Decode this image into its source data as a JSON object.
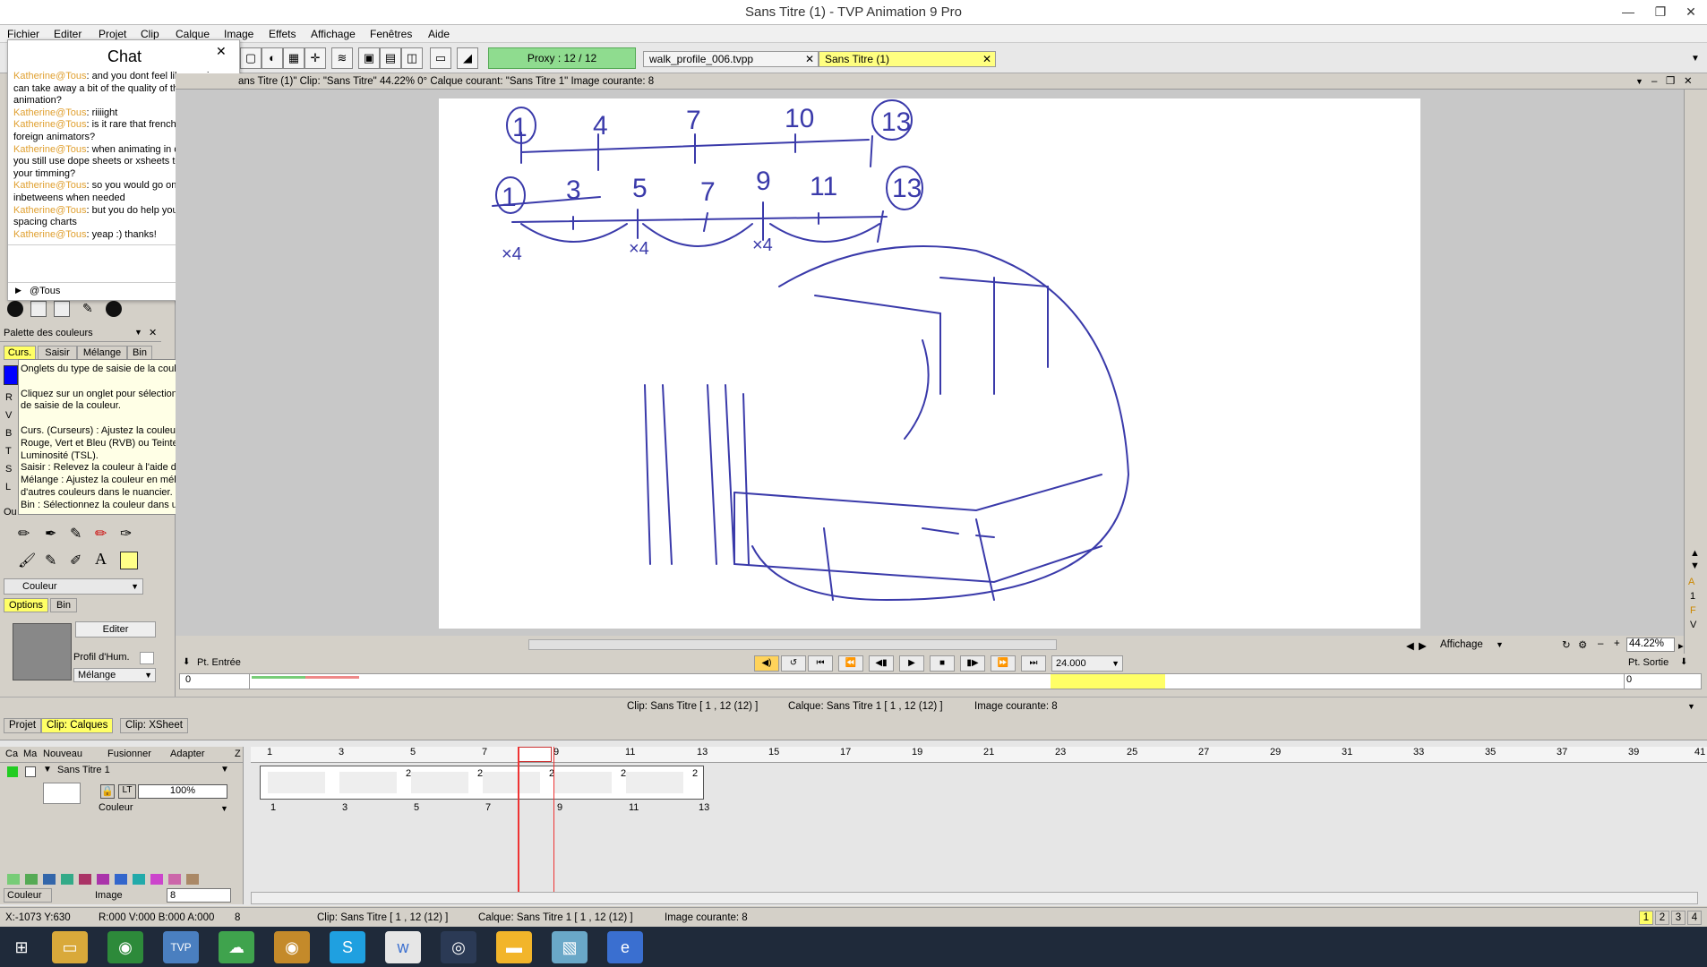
{
  "window": {
    "title": "Sans Titre (1) - TVP Animation 9 Pro",
    "min": "—",
    "max": "❐",
    "close": "✕"
  },
  "menu": [
    "Fichier",
    "Editer",
    "Projet",
    "Clip",
    "Calque",
    "Image",
    "Effets",
    "Affichage",
    "Fenêtres",
    "Aide"
  ],
  "toolbar": {
    "proxy": "Proxy : 12 / 12",
    "tabs": [
      {
        "label": "walk_profile_006.tvpp",
        "close": "✕"
      },
      {
        "label": "Sans Titre (1)",
        "close": "✕"
      }
    ]
  },
  "chat": {
    "title": "Chat",
    "close": "✕",
    "channel": "@Tous",
    "messages": [
      {
        "who": "Katherine@Tous",
        "text": ": and you dont feel like reusing can take away a bit of the quality of the animation?"
      },
      {
        "who": "Katherine@Tous",
        "text": ": riiiight"
      },
      {
        "who": "Katherine@Tous",
        "text": ": is it rare that french studios hire foreign animators?"
      },
      {
        "who": "Katherine@Tous",
        "text": ": when animating in digitally, do you still use dope sheets or xsheets to plan out your timming?"
      },
      {
        "who": "Katherine@Tous",
        "text": ": so you would go on with adding inbetweens when needed"
      },
      {
        "who": "Katherine@Tous",
        "text": ": but you do help yourself with spacing charts"
      },
      {
        "who": "Katherine@Tous",
        "text": ": yeap :) thanks!"
      }
    ]
  },
  "palette": {
    "title": "Palette des couleurs",
    "tabs": [
      "Curs.",
      "Saisir",
      "Mélange",
      "Bin"
    ],
    "channels": [
      "R",
      "V",
      "B",
      "T",
      "S",
      "L"
    ],
    "out_label": "Ou"
  },
  "tooltip": {
    "lines": [
      "Onglets du type de saisie de la couleur principale",
      "",
      "Cliquez sur un onglet pour sélectionner le type",
      "de saisie de la couleur.",
      "",
      "Curs. (Curseurs) : Ajustez la couleur selon les canaux",
      "Rouge, Vert et Bleu (RVB) ou Teinte, Saturation et",
      "Luminosité (TSL).",
      "Saisir : Relevez la couleur à l'aide d'une pipette.",
      "Mélange : Ajustez la couleur en mélangeant",
      "d'autres couleurs dans le nuancier.",
      "Bin : Sélectionnez la couleur dans une palette."
    ]
  },
  "tools": {
    "dropdown": "Couleur",
    "tabs": [
      "Options",
      "Bin"
    ],
    "edit_button": "Editer",
    "profile": "Profil d'Hum.",
    "mode": "Mélange"
  },
  "view": {
    "header": "ans Titre (1)\"  Clip: \"Sans Titre\"   44.22%   0°   Calque courant: \"Sans Titre 1\"   Image courante: 8"
  },
  "play": {
    "pt_entree": "Pt. Entrée",
    "pt_sortie": "Pt. Sortie",
    "fps": "24.000",
    "affichage": "Affichage",
    "zoom": "44.22%",
    "in_value": "0",
    "out_value": "0"
  },
  "right_labels": [
    "A",
    "1",
    "F",
    "V"
  ],
  "info": {
    "clip": "Clip: Sans Titre [ 1 , 12  (12) ]",
    "layer": "Calque: Sans Titre 1 [ 1 , 12  (12) ]",
    "image": "Image courante: 8"
  },
  "timeline": {
    "tabs": [
      "Projet",
      "Clip: Calques",
      "Clip: XSheet"
    ],
    "headers": [
      "Ca",
      "Ma",
      "Nouveau",
      "Fusionner",
      "Adapter",
      "Z"
    ],
    "layer": {
      "name": "Sans Titre 1",
      "opacity": "100%",
      "mode": "Couleur",
      "lt": "LT"
    },
    "ruler": [
      "1",
      "3",
      "5",
      "7",
      "9",
      "11",
      "13",
      "15",
      "17",
      "19",
      "21",
      "23",
      "25",
      "27",
      "29",
      "31",
      "33",
      "35",
      "37",
      "39",
      "41"
    ],
    "keys": [
      "1",
      "3",
      "5",
      "7",
      "9",
      "11",
      "13"
    ],
    "holds": [
      "2",
      "2",
      "2",
      "2",
      "2",
      "2"
    ],
    "bottom": {
      "color": "Couleur",
      "image": "Image",
      "value": "8"
    }
  },
  "status": {
    "coords": "X:-1073 Y:630",
    "rgba": "R:000 V:000 B:000 A:000",
    "num": "8",
    "clip": "Clip: Sans Titre [ 1 , 12  (12) ]",
    "layer": "Calque: Sans Titre 1 [ 1 , 12  (12) ]",
    "image": "Image courante: 8",
    "pages": [
      "1",
      "2",
      "3",
      "4"
    ]
  },
  "taskbar": {
    "apps": [
      {
        "name": "windows-start-icon",
        "glyph": "⊞",
        "color": "#1f2a3a"
      },
      {
        "name": "file-explorer-icon",
        "glyph": "▭",
        "color": "#d9a93a"
      },
      {
        "name": "chrome-icon",
        "glyph": "◉",
        "color": "#2d8a3a"
      },
      {
        "name": "tvpaint-icon",
        "glyph": "TVP",
        "color": "#4a7fc0"
      },
      {
        "name": "wechat-icon",
        "glyph": "☁",
        "color": "#3fa34d"
      },
      {
        "name": "chrome-canary-icon",
        "glyph": "◉",
        "color": "#c48a2a"
      },
      {
        "name": "skype-icon",
        "glyph": "S",
        "color": "#1fa0e0"
      },
      {
        "name": "wunderlist-icon",
        "glyph": "w",
        "color": "#e6e6e6"
      },
      {
        "name": "steam-icon",
        "glyph": "◎",
        "color": "#2b3a55"
      },
      {
        "name": "folder-icon",
        "glyph": "▬",
        "color": "#f2b52a"
      },
      {
        "name": "notes-icon",
        "glyph": "▧",
        "color": "#6aa8c8"
      },
      {
        "name": "browser-icon",
        "glyph": "e",
        "color": "#3a6fd0"
      }
    ]
  }
}
